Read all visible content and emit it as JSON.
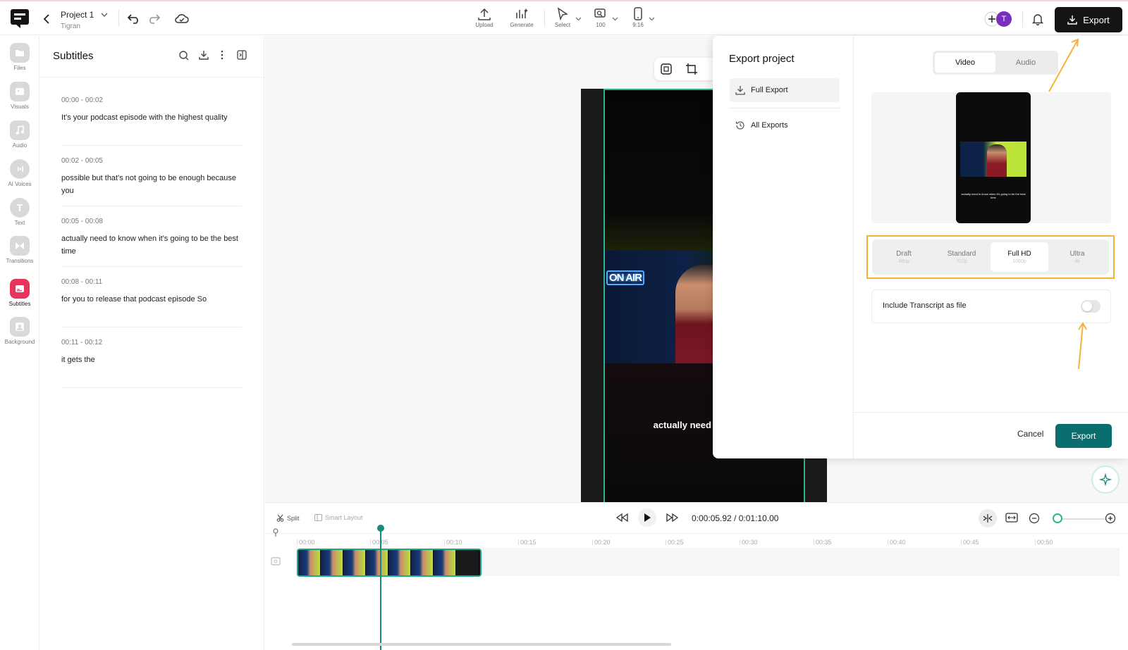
{
  "header": {
    "project_title": "Project 1",
    "project_subtitle": "Tigran",
    "tools": [
      {
        "label": "Upload",
        "icon": "upload-icon"
      },
      {
        "label": "Generate",
        "icon": "generate-icon"
      },
      {
        "label": "Select",
        "icon": "cursor-icon"
      },
      {
        "label": "100",
        "icon": "zoom-icon"
      },
      {
        "label": "9:16",
        "icon": "phone-icon"
      }
    ],
    "avatar_initial": "T",
    "export_label": "Export"
  },
  "left_rail": {
    "items": [
      {
        "label": "Files",
        "icon": "files-icon"
      },
      {
        "label": "Visuals",
        "icon": "visuals-icon"
      },
      {
        "label": "Audio",
        "icon": "music-note-icon"
      },
      {
        "label": "AI Voices",
        "icon": "ai-voices-icon"
      },
      {
        "label": "Text",
        "icon": "text-icon"
      },
      {
        "label": "Transitions",
        "icon": "transitions-icon"
      },
      {
        "label": "Subtitles",
        "icon": "subtitles-icon",
        "active": true
      },
      {
        "label": "Background",
        "icon": "background-icon"
      }
    ]
  },
  "subtitles": {
    "title": "Subtitles",
    "entries": [
      {
        "time": "00:00 - 00:02",
        "text": "It's your podcast episode with the highest quality"
      },
      {
        "time": "00:02 - 00:05",
        "text": "possible but that's not going to be enough because you"
      },
      {
        "time": "00:05 - 00:08",
        "text": "actually need to know when it's going to be the best time"
      },
      {
        "time": "00:08 - 00:11",
        "text": "for you to release that podcast episode So"
      },
      {
        "time": "00:11 - 00:12",
        "text": "it gets the"
      }
    ]
  },
  "video": {
    "sign_text": "ON AIR",
    "caption_line1": "actually need to know w",
    "caption_line2": "the best t"
  },
  "export_modal": {
    "title": "Export project",
    "nav": [
      {
        "label": "Full Export",
        "icon": "download-icon",
        "active": true
      },
      {
        "label": "All Exports",
        "icon": "history-icon",
        "active": false
      }
    ],
    "tabs": [
      {
        "label": "Video",
        "active": true
      },
      {
        "label": "Audio",
        "active": false
      }
    ],
    "preview_caption": "actually need to know when it's going to be the best time",
    "quality_options": [
      {
        "name": "Draft",
        "res": "480p",
        "active": false
      },
      {
        "name": "Standard",
        "res": "720p",
        "active": false
      },
      {
        "name": "Full HD",
        "res": "1080p",
        "active": true
      },
      {
        "name": "Ultra",
        "res": "4k",
        "active": false
      }
    ],
    "transcript_label": "Include Transcript as file",
    "transcript_enabled": false,
    "cancel_label": "Cancel",
    "export_label": "Export"
  },
  "timeline": {
    "split_label": "Split",
    "smart_layout_label": "Smart Layout",
    "current_time": "0:00:05.92",
    "total_time": "0:01:10.00",
    "ruler": [
      "00:00",
      "00:05",
      "00:10",
      "00:15",
      "00:20",
      "00:25",
      "00:30",
      "00:35",
      "00:40",
      "00:45",
      "00:50"
    ]
  },
  "colors": {
    "accent_teal": "#0b6e6e",
    "highlight_orange": "#f6b13c",
    "subtitles_active": "#e8345a",
    "avatar_purple": "#7b2fbf"
  }
}
